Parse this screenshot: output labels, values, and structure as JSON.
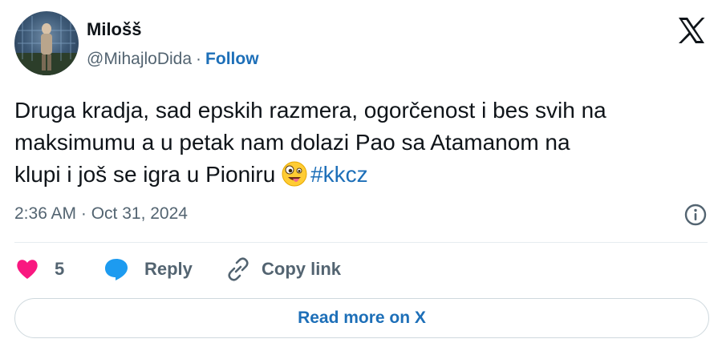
{
  "author": {
    "display_name": "Milošš",
    "handle": "@MihajloDida",
    "separator": "·",
    "follow_label": "Follow"
  },
  "tweet": {
    "text_line1": "Druga kradja, sad epskih razmera, ogorčenost i bes svih na",
    "text_line2": "maksimumu a u petak nam dolazi Pao sa Atamanom na",
    "text_line3_prefix": "klupi i još se igra u Pioniru",
    "emoji": "zany-face-emoji",
    "hashtag": "#kkcz",
    "timestamp": "2:36 AM · Oct 31, 2024"
  },
  "actions": {
    "like_count": "5",
    "reply_label": "Reply",
    "copy_link_label": "Copy link"
  },
  "read_more_label": "Read more on X",
  "colors": {
    "accent": "#1d6fb8",
    "heart": "#f91880",
    "reply_bubble": "#1d9bf0",
    "secondary_text": "#536471"
  },
  "icons": [
    "x-logo-icon",
    "info-icon",
    "heart-icon",
    "reply-bubble-icon",
    "link-icon"
  ]
}
